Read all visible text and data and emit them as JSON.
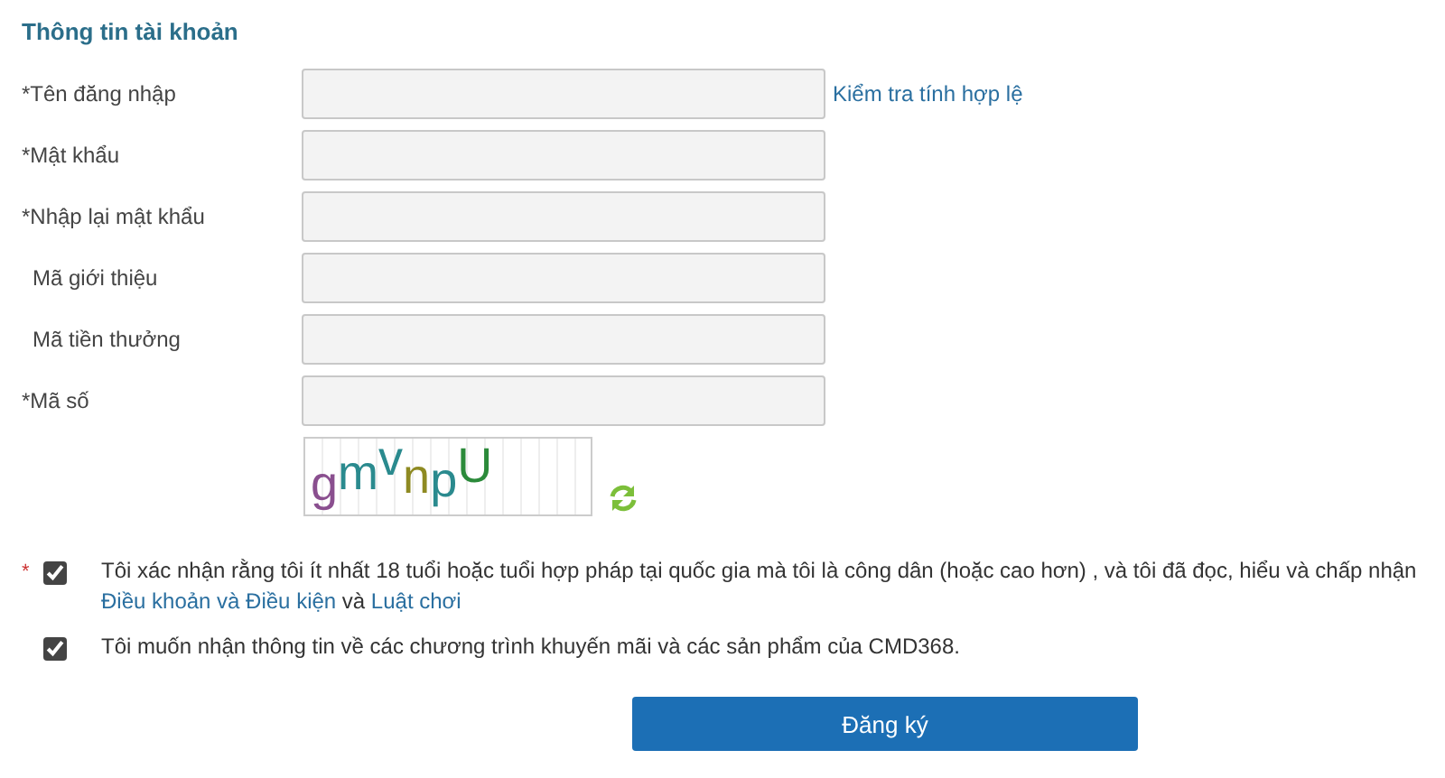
{
  "section_title": "Thông tin tài khoản",
  "fields": [
    {
      "label": "*Tên đăng nhập",
      "link": "Kiểm tra tính hợp lệ"
    },
    {
      "label": "*Mật khẩu"
    },
    {
      "label": "*Nhập lại mật khẩu"
    },
    {
      "label": "Mã giới thiệu",
      "indent": true
    },
    {
      "label": "Mã tiền thưởng",
      "indent": true
    },
    {
      "label": "*Mã số"
    }
  ],
  "captcha": {
    "text": "gmvnpU"
  },
  "agreements": [
    {
      "marker": "*",
      "checked": true,
      "text": "Tôi xác nhận rằng tôi ít nhất 18 tuổi hoặc tuổi hợp pháp tại quốc gia mà tôi là công dân (hoặc cao hơn) , và tôi đã đọc, hiểu và chấp nhận",
      "links": [
        "Điều khoản và Điều kiện",
        "Luật chơi"
      ],
      "joiner": "và"
    },
    {
      "checked": true,
      "text": "Tôi muốn nhận thông tin về các chương trình khuyến mãi và các sản phẩm của CMD368."
    }
  ],
  "submit": "Đăng ký"
}
